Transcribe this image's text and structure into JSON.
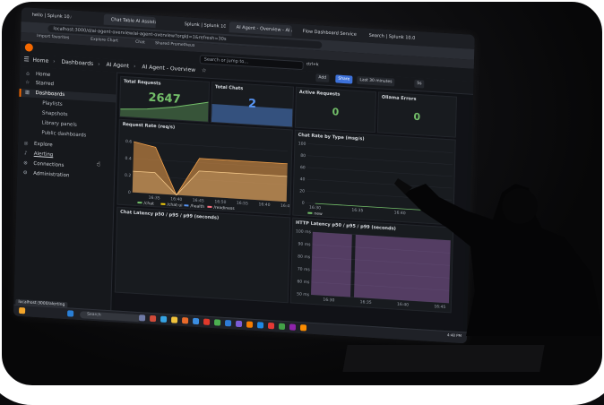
{
  "browser": {
    "tabs": [
      "hello | Splunk 10.0.0",
      "Chat Table AI Assistant",
      "Splunk | Splunk 10.0.0",
      "AI Agent - Overview - AI Age...",
      "Flow Dashboard Service",
      "Search | Splunk 10.0.0"
    ],
    "url": "localhost:3000/d/ai-agent-overview/ai-agent-overview?orgId=1&refresh=30s",
    "bookmarks": [
      "Import favorites",
      "Explore Chart",
      "Chat",
      "Shared Prometheus"
    ]
  },
  "grafana": {
    "search_placeholder": "Search or jump to...",
    "search_shortcut": "ctrl+k",
    "breadcrumbs": [
      "Home",
      "Dashboards",
      "AI Agent",
      "AI Agent - Overview"
    ],
    "toolbar": {
      "add_label": "Add",
      "share_label": "Share",
      "time_range": "Last 30 minutes",
      "refresh_label": "5s"
    }
  },
  "sidebar": {
    "items": [
      {
        "label": "Home",
        "icon": "home-icon"
      },
      {
        "label": "Starred",
        "icon": "star-icon"
      },
      {
        "label": "Dashboards",
        "icon": "grid-icon"
      },
      {
        "label": "Playlists"
      },
      {
        "label": "Snapshots"
      },
      {
        "label": "Library panels"
      },
      {
        "label": "Public dashboards"
      },
      {
        "label": "Explore",
        "icon": "compass-icon"
      },
      {
        "label": "Alerting",
        "icon": "bell-icon"
      },
      {
        "label": "Connections",
        "icon": "plug-icon"
      },
      {
        "label": "Administration",
        "icon": "gear-icon"
      }
    ]
  },
  "panels": {
    "total_requests": {
      "title": "Total Requests",
      "value": "2647",
      "color": "#73bf69"
    },
    "total_chats": {
      "title": "Total Chats",
      "value": "2",
      "color": "#5794f2"
    },
    "active_requests": {
      "title": "Active Requests",
      "value": "0",
      "color": "#73bf69"
    },
    "ollama_errors": {
      "title": "Ollama Errors",
      "value": "0",
      "color": "#73bf69"
    },
    "request_rate": {
      "title": "Request Rate (req/s)"
    },
    "chat_rate": {
      "title": "Chat Rate by Type (msg/s)"
    },
    "chat_latency": {
      "title": "Chat Latency p50 / p95 / p99 (seconds)"
    },
    "http_latency": {
      "title": "HTTP Latency p50 / p95 / p99 (seconds)"
    }
  },
  "chart_data": [
    {
      "type": "line",
      "title": "Request Rate (req/s)",
      "x": [
        "16:30",
        "16:35",
        "16:40",
        "16:45",
        "16:50",
        "16:55",
        "16:40",
        "16:45"
      ],
      "y_ticks": [
        "0",
        "0.2",
        "0.4",
        "0.6"
      ],
      "ylim": [
        0,
        0.7
      ],
      "legend": [
        "/chat",
        "/chat-ui",
        "/health",
        "/readiness"
      ],
      "series": [
        {
          "name": "/chat",
          "values": [
            0.6,
            0.55,
            0,
            0.45,
            0.45,
            0.45,
            0.45,
            0.45
          ]
        },
        {
          "name": "/chat-ui",
          "values": [
            0.25,
            0.25,
            0,
            0.3,
            0.3,
            0.3,
            0.3,
            0.3
          ]
        }
      ]
    },
    {
      "type": "line",
      "title": "Chat Rate by Type (msg/s)",
      "x": [
        "16:30",
        "16:35",
        "16:40",
        "16:45"
      ],
      "y_ticks": [
        "0",
        "20",
        "40",
        "60",
        "80",
        "100"
      ],
      "ylim": [
        0,
        100
      ],
      "legend": [
        "new"
      ],
      "series": [
        {
          "name": "new",
          "values": [
            0,
            0,
            0,
            0
          ]
        }
      ]
    },
    {
      "type": "area",
      "title": "HTTP Latency p50 / p95 / p99 (seconds)",
      "x": [
        "16:30",
        "16:35",
        "16:40",
        "16:45"
      ],
      "y_ticks": [
        "50 ms",
        "60 ms",
        "70 ms",
        "80 ms",
        "90 ms",
        "100 ms"
      ],
      "ylim": [
        50,
        100
      ]
    }
  ],
  "taskbar": {
    "search_placeholder": "Search",
    "status_url": "localhost:3000/alerting",
    "time": "4:48 PM"
  }
}
